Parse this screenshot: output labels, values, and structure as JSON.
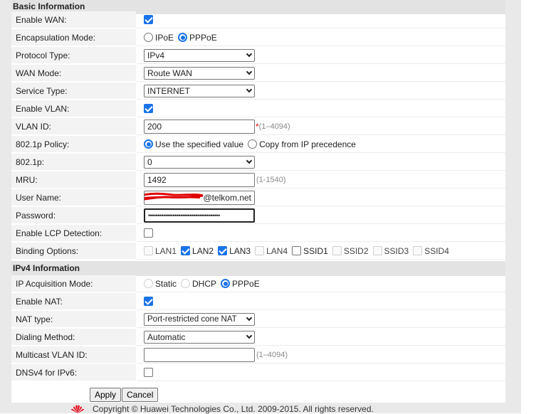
{
  "sections": {
    "basic": "Basic Information",
    "ipv4": "IPv4 Information"
  },
  "basic": {
    "enable_wan": {
      "label": "Enable WAN:",
      "checked": true
    },
    "encapsulation": {
      "label": "Encapsulation Mode:",
      "options": [
        "IPoE",
        "PPPoE"
      ],
      "selected": "PPPoE"
    },
    "protocol_type": {
      "label": "Protocol Type:",
      "value": "IPv4"
    },
    "wan_mode": {
      "label": "WAN Mode:",
      "value": "Route WAN"
    },
    "service_type": {
      "label": "Service Type:",
      "value": "INTERNET"
    },
    "enable_vlan": {
      "label": "Enable VLAN:",
      "checked": true
    },
    "vlan_id": {
      "label": "VLAN ID:",
      "value": "200",
      "required": "*",
      "hint": "(1–4094)"
    },
    "policy_8021p": {
      "label": "802.1p Policy:",
      "options": [
        "Use the specified value",
        "Copy from IP precedence"
      ],
      "selected": "Use the specified value"
    },
    "value_8021p": {
      "label": "802.1p:",
      "value": "0"
    },
    "mru": {
      "label": "MRU:",
      "value": "1492",
      "hint": "(1-1540)"
    },
    "user_name": {
      "label": "User Name:",
      "value_visible": "@telkom.net"
    },
    "password": {
      "label": "Password:",
      "value": "••••••••••••••••••••••••••••••••••••••"
    },
    "enable_lcp": {
      "label": "Enable LCP Detection:",
      "checked": false
    },
    "binding": {
      "label": "Binding Options:",
      "items": [
        {
          "name": "LAN1",
          "checked": false
        },
        {
          "name": "LAN2",
          "checked": true
        },
        {
          "name": "LAN3",
          "checked": true
        },
        {
          "name": "LAN4",
          "checked": false
        },
        {
          "name": "SSID1",
          "checked": false
        },
        {
          "name": "SSID2",
          "checked": false
        },
        {
          "name": "SSID3",
          "checked": false
        },
        {
          "name": "SSID4",
          "checked": false
        }
      ]
    }
  },
  "ipv4": {
    "acquisition": {
      "label": "IP Acquisition Mode:",
      "options": [
        "Static",
        "DHCP",
        "PPPoE"
      ],
      "selected": "PPPoE"
    },
    "enable_nat": {
      "label": "Enable NAT:",
      "checked": true
    },
    "nat_type": {
      "label": "NAT type:",
      "value": "Port-restricted cone NAT"
    },
    "dialing": {
      "label": "Dialing Method:",
      "value": "Automatic"
    },
    "multicast_vlan": {
      "label": "Multicast VLAN ID:",
      "value": "",
      "hint": "(1–4094)"
    },
    "dnsv4": {
      "label": "DNSv4 for IPv6:",
      "checked": false
    }
  },
  "buttons": {
    "apply": "Apply",
    "cancel": "Cancel"
  },
  "footer": {
    "copyright": "Copyright © Huawei Technologies Co., Ltd. 2009-2015. All rights reserved.",
    "logo_icon": "huawei-logo-icon"
  },
  "colors": {
    "accent": "#1a73e8",
    "section_bg": "#e3e3e3",
    "label_bg": "#f3f3f3",
    "required": "#e00000",
    "logo": "#e60012"
  }
}
